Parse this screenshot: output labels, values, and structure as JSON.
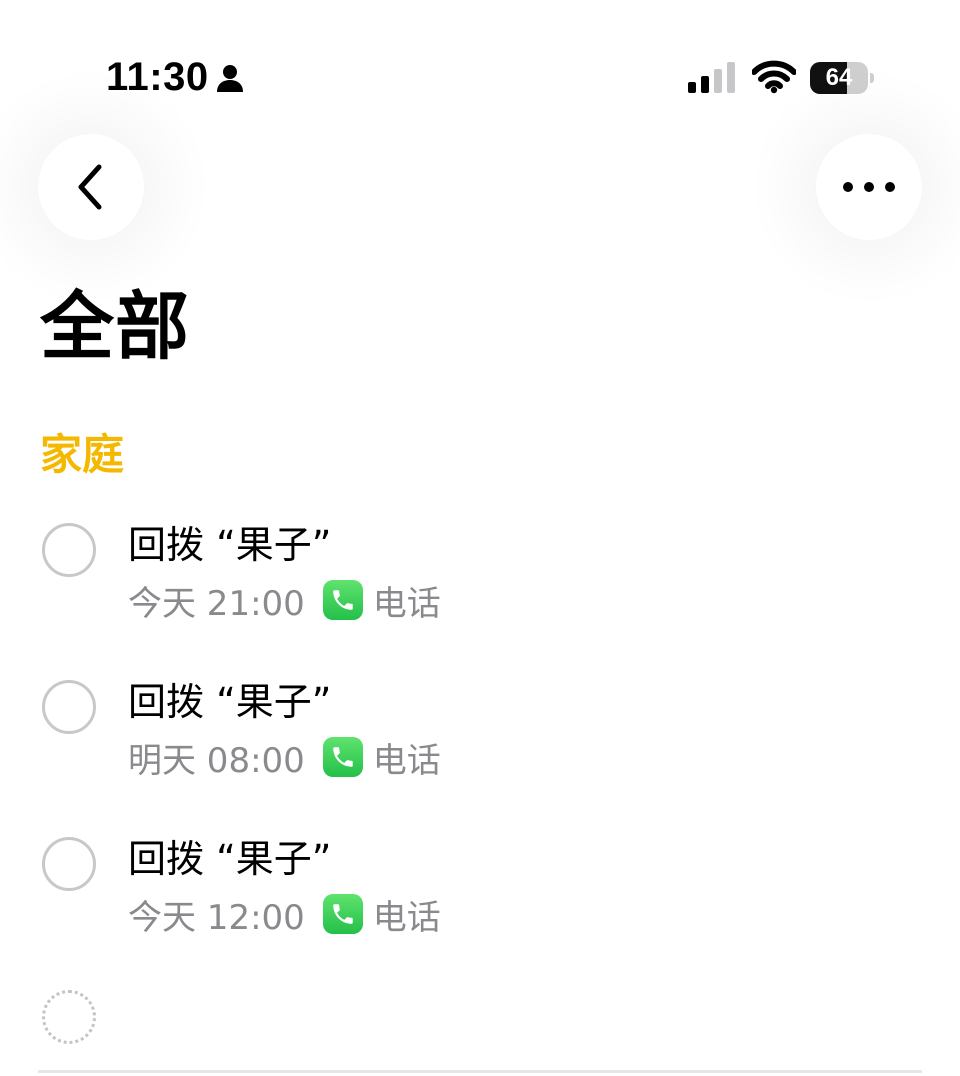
{
  "status_bar": {
    "time": "11:30",
    "battery_percent": 64,
    "battery_label": "64",
    "person_icon": "person-icon",
    "signal_icon": "cellular-signal-icon",
    "wifi_icon": "wifi-icon"
  },
  "nav": {
    "back_icon": "chevron-left-icon",
    "more_icon": "ellipsis-icon"
  },
  "page": {
    "title": "全部"
  },
  "section": {
    "title": "家庭",
    "accent_color": "#f5b800"
  },
  "reminders": [
    {
      "title": "回拨 “果子”",
      "time": "今天 21:00",
      "action_label": "电话"
    },
    {
      "title": "回拨 “果子”",
      "time": "明天 08:00",
      "action_label": "电话"
    },
    {
      "title": "回拨 “果子”",
      "time": "今天 12:00",
      "action_label": "电话"
    }
  ],
  "icons": {
    "phone_badge": "phone-icon",
    "new_item": "new-reminder-circle-icon"
  }
}
